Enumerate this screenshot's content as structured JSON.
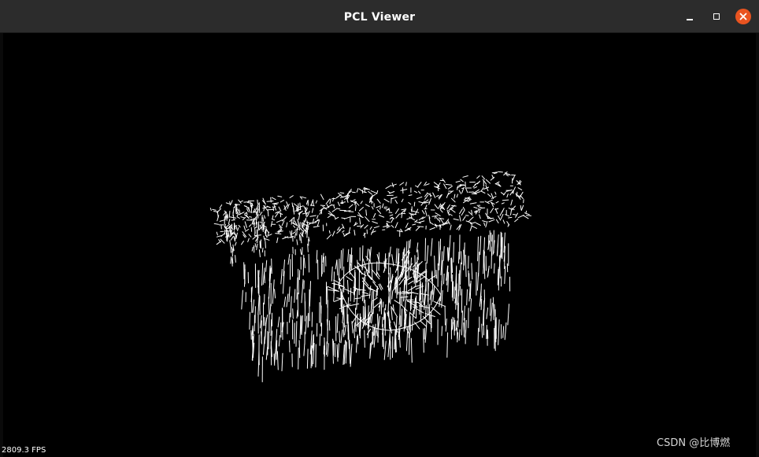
{
  "window": {
    "title": "PCL Viewer"
  },
  "titlebar_buttons": {
    "minimize_icon": "minimize-icon",
    "maximize_icon": "maximize-icon",
    "close_icon": "close-icon",
    "close_color": "#e95420"
  },
  "viewer": {
    "background_color": "#000000",
    "cloud_color": "#ffffff",
    "fps_text": "2809.3 FPS"
  },
  "watermark": {
    "text": "CSDN @比博燃"
  }
}
